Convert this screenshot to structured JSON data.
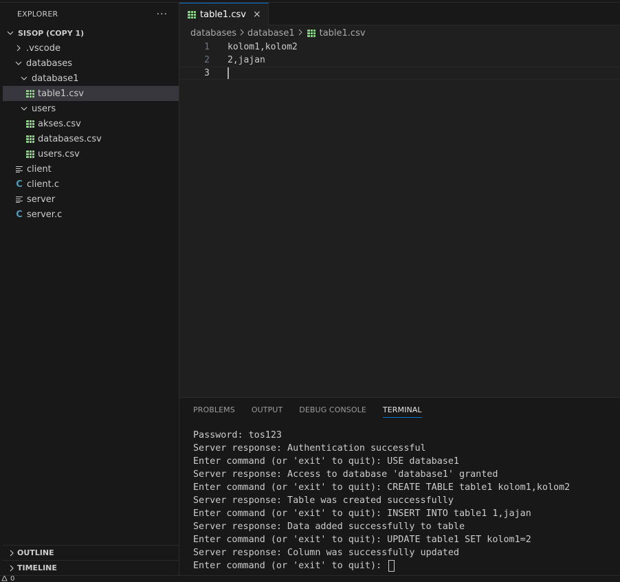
{
  "explorer": {
    "title": "EXPLORER",
    "more": "···",
    "root": "SISOP (COPY 1)",
    "items": [
      {
        "label": ".vscode"
      },
      {
        "label": "databases"
      },
      {
        "label": "database1"
      },
      {
        "label": "table1.csv"
      },
      {
        "label": "users"
      },
      {
        "label": "akses.csv"
      },
      {
        "label": "databases.csv"
      },
      {
        "label": "users.csv"
      },
      {
        "label": "client"
      },
      {
        "label": "client.c"
      },
      {
        "label": "server"
      },
      {
        "label": "server.c"
      }
    ],
    "outline": "OUTLINE",
    "timeline": "TIMELINE"
  },
  "editor": {
    "tab": {
      "label": "table1.csv",
      "close": "×"
    },
    "breadcrumb": [
      "databases",
      "database1",
      "table1.csv"
    ],
    "lines": [
      {
        "num": "1",
        "text": "kolom1,kolom2"
      },
      {
        "num": "2",
        "text": "2,jajan"
      },
      {
        "num": "3",
        "text": ""
      }
    ]
  },
  "panel": {
    "tabs": [
      "PROBLEMS",
      "OUTPUT",
      "DEBUG CONSOLE",
      "TERMINAL"
    ],
    "terminal": [
      "Password: tos123",
      "Server response: Authentication successful",
      "Enter command (or 'exit' to quit): USE database1",
      "Server response: Access to database 'database1' granted",
      "Enter command (or 'exit' to quit): CREATE TABLE table1 kolom1,kolom2",
      "Server response: Table was created successfully",
      "Enter command (or 'exit' to quit): INSERT INTO table1 1,jajan",
      "Server response: Data added successfully to table",
      "Enter command (or 'exit' to quit): UPDATE table1 SET kolom1=2",
      "Server response: Column was successfully updated",
      "Enter command (or 'exit' to quit): "
    ]
  },
  "status": {
    "warnings": "0"
  },
  "colors": {
    "accent": "#0078d4",
    "csv": "#89d185",
    "c_file": "#519aba"
  }
}
